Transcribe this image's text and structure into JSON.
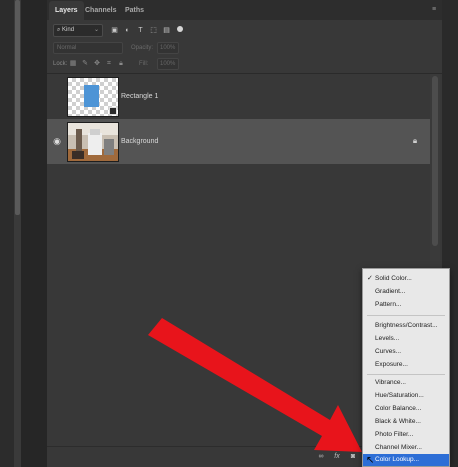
{
  "tabs": [
    "Layers",
    "Channels",
    "Paths"
  ],
  "filter": {
    "kind_label": "Kind"
  },
  "blend": {
    "mode": "Normal",
    "opacity_label": "Opacity:",
    "opacity_value": "100%",
    "fill_label": "Fill:",
    "fill_value": "100%"
  },
  "lock": {
    "label": "Lock:"
  },
  "layers": [
    {
      "name": "Rectangle 1",
      "visible": false,
      "selected": false
    },
    {
      "name": "Background",
      "visible": true,
      "selected": true,
      "locked": true
    }
  ],
  "bottom_icons": [
    "link-icon",
    "fx-icon",
    "mask-icon"
  ],
  "bottom_labels": {
    "link": "∞",
    "fx": "fx"
  },
  "menu": {
    "items": [
      {
        "label": "Solid Color...",
        "checked": true
      },
      {
        "label": "Gradient..."
      },
      {
        "label": "Pattern..."
      },
      {
        "label": "Brightness/Contrast..."
      },
      {
        "label": "Levels..."
      },
      {
        "label": "Curves..."
      },
      {
        "label": "Exposure..."
      },
      {
        "label": "Vibrance..."
      },
      {
        "label": "Hue/Saturation..."
      },
      {
        "label": "Color Balance..."
      },
      {
        "label": "Black & White..."
      },
      {
        "label": "Photo Filter..."
      },
      {
        "label": "Channel Mixer..."
      },
      {
        "label": "Color Lookup...",
        "highlighted": true
      }
    ]
  },
  "colors": {
    "accent": "#2d6ed6",
    "arrow": "#e8141b",
    "layer_blue": "#4d94d6"
  }
}
